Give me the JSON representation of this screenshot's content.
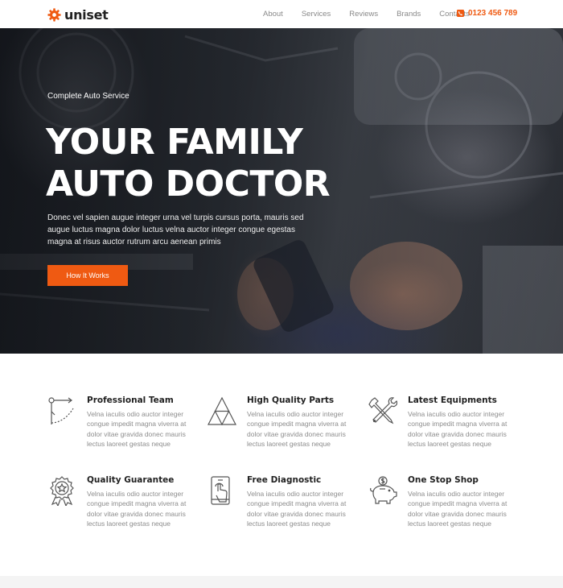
{
  "brand": {
    "name": "uniset",
    "accent": "#ef5a12"
  },
  "nav": {
    "items": [
      "About",
      "Services",
      "Reviews",
      "Brands",
      "Contacts"
    ],
    "phone": "0123 456 789"
  },
  "hero": {
    "eyebrow": "Complete Auto Service",
    "headline_line1": "YOUR FAMILY",
    "headline_line2": "AUTO DOCTOR",
    "lead": "Donec vel sapien augue integer urna vel turpis cursus porta, mauris sed augue luctus magna dolor luctus velna auctor integer congue egestas magna at risus auctor rutrum arcu aenean primis",
    "cta_label": "How It Works"
  },
  "features": [
    {
      "title": "Professional Team",
      "icon": "compass-icon",
      "text": "Velna iaculis odio auctor integer congue impedit magna viverra at dolor vitae gravida donec mauris lectus laoreet gestas neque"
    },
    {
      "title": "High Quality Parts",
      "icon": "triangle-icon",
      "text": "Velna iaculis odio auctor integer congue impedit magna viverra at dolor vitae gravida donec mauris lectus laoreet gestas neque"
    },
    {
      "title": "Latest Equipments",
      "icon": "tools-icon",
      "text": "Velna iaculis odio auctor integer congue impedit magna viverra at dolor vitae gravida donec mauris lectus laoreet gestas neque"
    },
    {
      "title": "Quality Guarantee",
      "icon": "award-badge-icon",
      "text": "Velna iaculis odio auctor integer congue impedit magna viverra at dolor vitae gravida donec mauris lectus laoreet gestas neque"
    },
    {
      "title": "Free Diagnostic",
      "icon": "tablet-touch-icon",
      "text": "Velna iaculis odio auctor integer congue impedit magna viverra at dolor vitae gravida donec mauris lectus laoreet gestas neque"
    },
    {
      "title": "One Stop Shop",
      "icon": "piggy-bank-icon",
      "text": "Velna iaculis odio auctor integer congue impedit magna viverra at dolor vitae gravida donec mauris lectus laoreet gestas neque"
    }
  ]
}
